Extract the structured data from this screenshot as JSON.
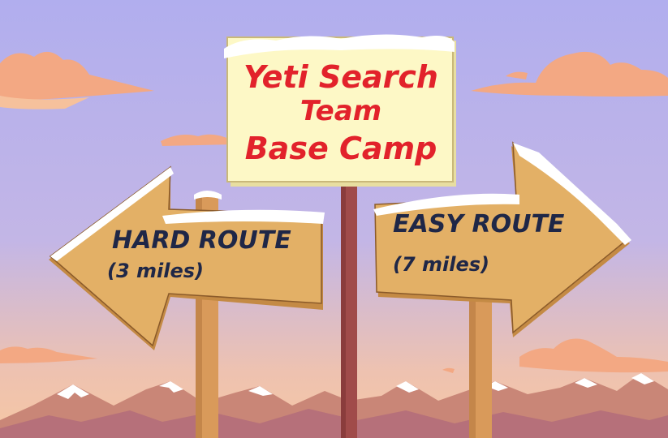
{
  "center_sign": {
    "line1": "Yeti Search",
    "line2": "Team",
    "line3": "Base Camp",
    "text_color": "#e2222b"
  },
  "left_arrow": {
    "title": "HARD ROUTE",
    "distance": "(3 miles)",
    "direction": "left"
  },
  "right_arrow": {
    "title": "EASY ROUTE",
    "distance": "(7 miles)",
    "direction": "right"
  },
  "colors": {
    "sky_top": "#b3b0ee",
    "sky_bottom": "#f1c0a6",
    "wood": "#e3b066",
    "wood_dark": "#c48a44",
    "post": "#d99a5a",
    "center_post": "#a04b4a",
    "sign_board": "#fdf8c6",
    "snow": "#ffffff",
    "clouds": "#f3a883",
    "mountains": "#c98677",
    "text_dark": "#1f2747"
  }
}
